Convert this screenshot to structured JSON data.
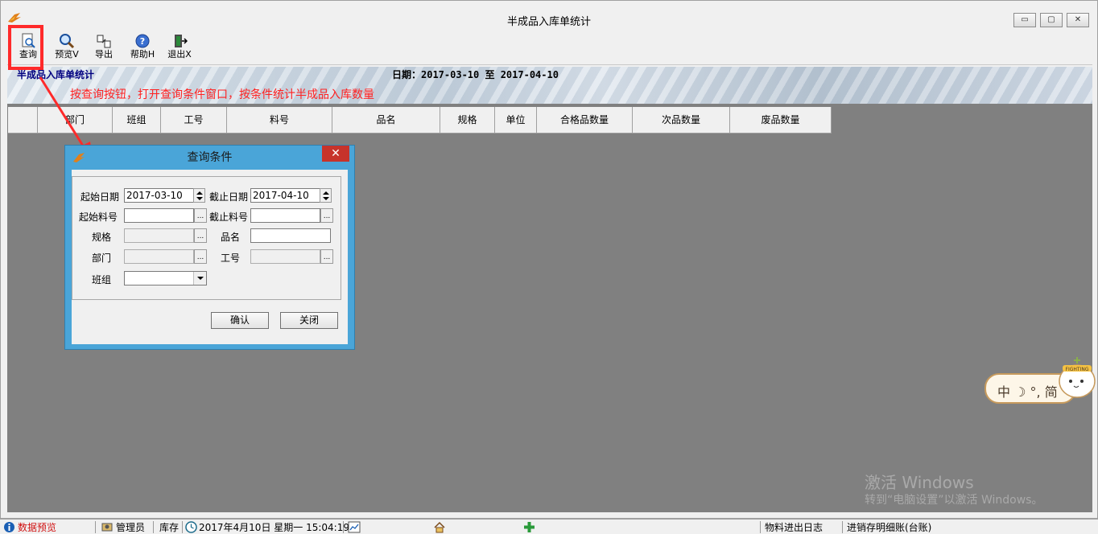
{
  "window": {
    "title": "半成品入库单统计",
    "controls": {
      "minimize": "▭",
      "restore": "▢",
      "close": "✕"
    }
  },
  "toolbar": {
    "query": "查询",
    "preview": "预览V",
    "export": "导出",
    "help": "帮助H",
    "exit": "退出X"
  },
  "banner": {
    "title": "半成品入库单统计",
    "date_label": "日期：2017-03-10 至 2017-04-10",
    "hint": "按查询按钮，打开查询条件窗口，按条件统计半成品入库数量"
  },
  "grid": {
    "columns": [
      "",
      "部门",
      "班组",
      "工号",
      "料号",
      "品名",
      "规格",
      "单位",
      "合格品数量",
      "次品数量",
      "废品数量"
    ]
  },
  "dialog": {
    "title": "查询条件",
    "close": "✕",
    "start_date_label": "起始日期",
    "start_date": "2017-03-10",
    "end_date_label": "截止日期",
    "end_date": "2017-04-10",
    "start_part_label": "起始料号",
    "start_part": "",
    "end_part_label": "截止料号",
    "end_part": "",
    "spec_label": "规格",
    "spec": "",
    "product_name_label": "品名",
    "product_name": "",
    "dept_label": "部门",
    "dept": "",
    "job_no_label": "工号",
    "job_no": "",
    "team_label": "班组",
    "team": "",
    "ellipsis": "...",
    "confirm": "确认",
    "close_button": "关闭"
  },
  "statusbar": {
    "data_preview": "数据预览",
    "user": "管理员",
    "module": "库存",
    "datetime": "2017年4月10日 星期一 15:04:19",
    "log": "物料进出日志",
    "detail": "进销存明细账(台账)"
  },
  "ime": {
    "text": "中 ☽ °, 简",
    "mascot_text": "FIGHTING"
  },
  "watermark": {
    "line1": "激活 Windows",
    "line2": "转到“电脑设置”以激活 Windows。"
  },
  "colors": {
    "hint_red": "#ff2020",
    "banner_title_blue": "#000080",
    "dialog_frame": "#4aa5d8",
    "close_red": "#c7332b",
    "grid_bg": "#808080"
  }
}
